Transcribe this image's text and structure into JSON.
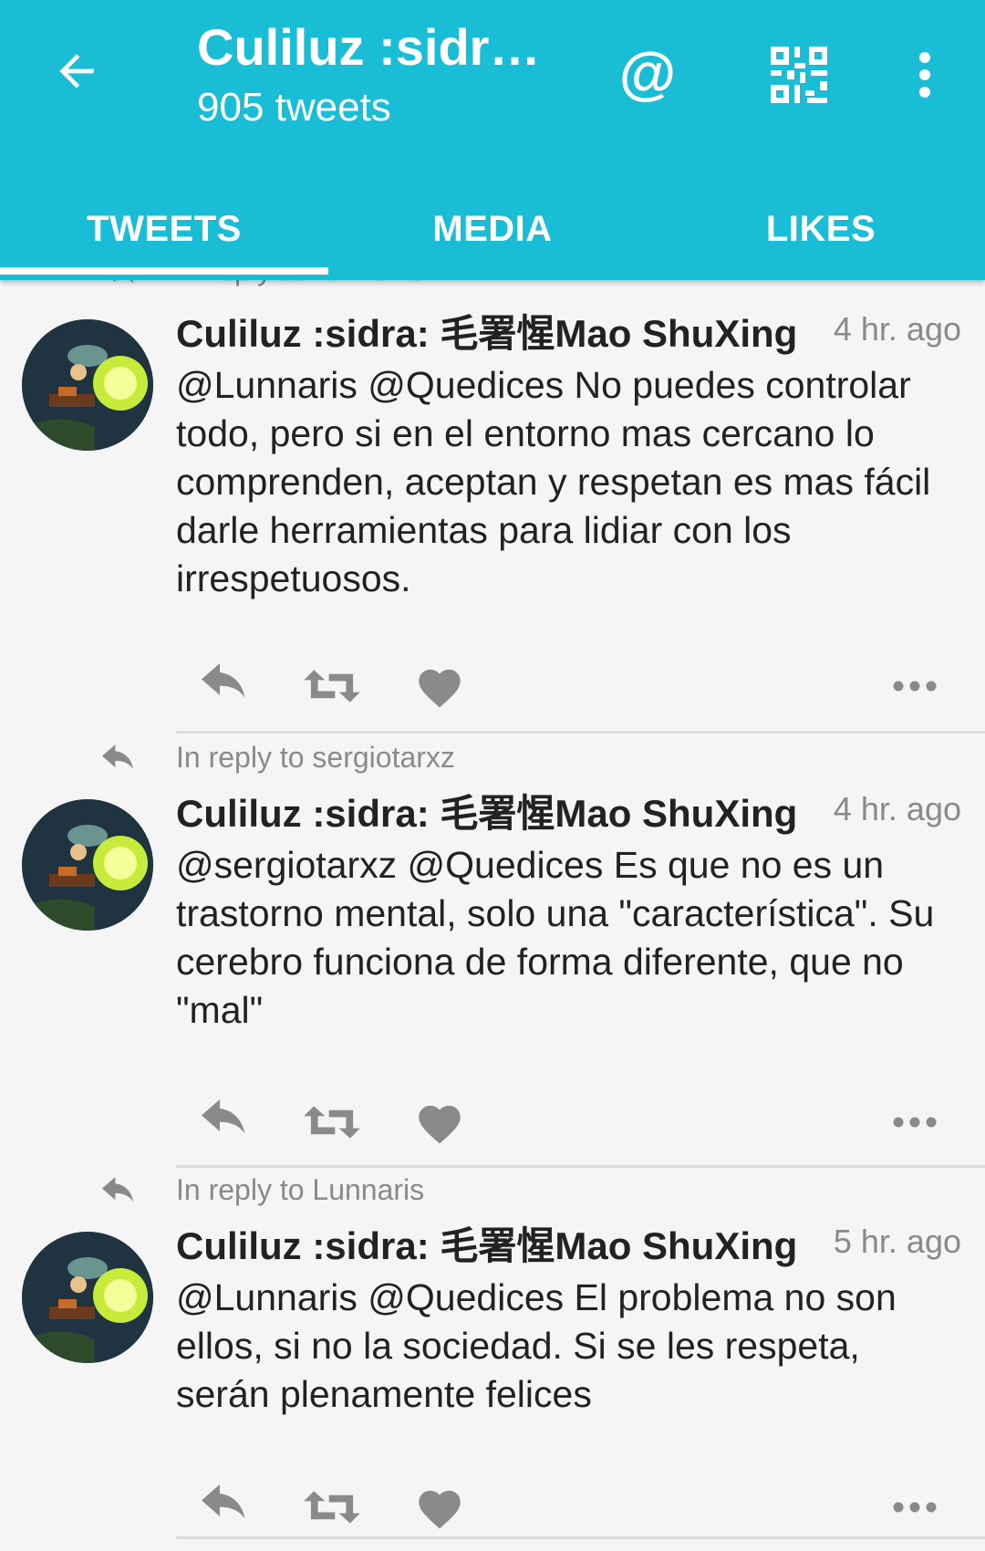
{
  "header": {
    "title": "Culiluz :sidr…",
    "subtitle": "905 tweets",
    "at_symbol": "@",
    "colors": {
      "bar": "#19bdd6",
      "text": "#ffffff"
    }
  },
  "tabs": [
    {
      "label": "TWEETS",
      "active": true
    },
    {
      "label": "MEDIA",
      "active": false
    },
    {
      "label": "LIKES",
      "active": false
    }
  ],
  "tweets": [
    {
      "reply_to": "In reply to Lunnaris",
      "author": "Culiluz :sidra: 毛署惺Mao ShuXing",
      "time": "4 hr. ago",
      "text": "@Lunnaris @Quedices No puedes controlar todo, pero si en el entorno mas cercano lo comprenden, aceptan y respetan es mas fácil darle herramientas para lidiar con los irrespetuosos."
    },
    {
      "reply_to": "In reply to sergiotarxz",
      "author": "Culiluz :sidra: 毛署惺Mao ShuXing",
      "time": "4 hr. ago",
      "text": "@sergiotarxz @Quedices Es que no es un trastorno mental, solo una \"característica\". Su cerebro funciona de forma diferente, que no \"mal\""
    },
    {
      "reply_to": "In reply to Lunnaris",
      "author": "Culiluz :sidra: 毛署惺Mao ShuXing",
      "time": "5 hr. ago",
      "text": "@Lunnaris @Quedices El problema no son ellos, si no la sociedad. Si se les respeta, serán plenamente felices"
    }
  ],
  "icons": {
    "back": "arrow-left-icon",
    "mention": "at-icon",
    "qr": "qr-code-icon",
    "overflow": "more-vert-icon",
    "reply": "reply-icon",
    "retweet": "retweet-icon",
    "like": "heart-icon",
    "tweet_more": "more-horiz-icon"
  }
}
